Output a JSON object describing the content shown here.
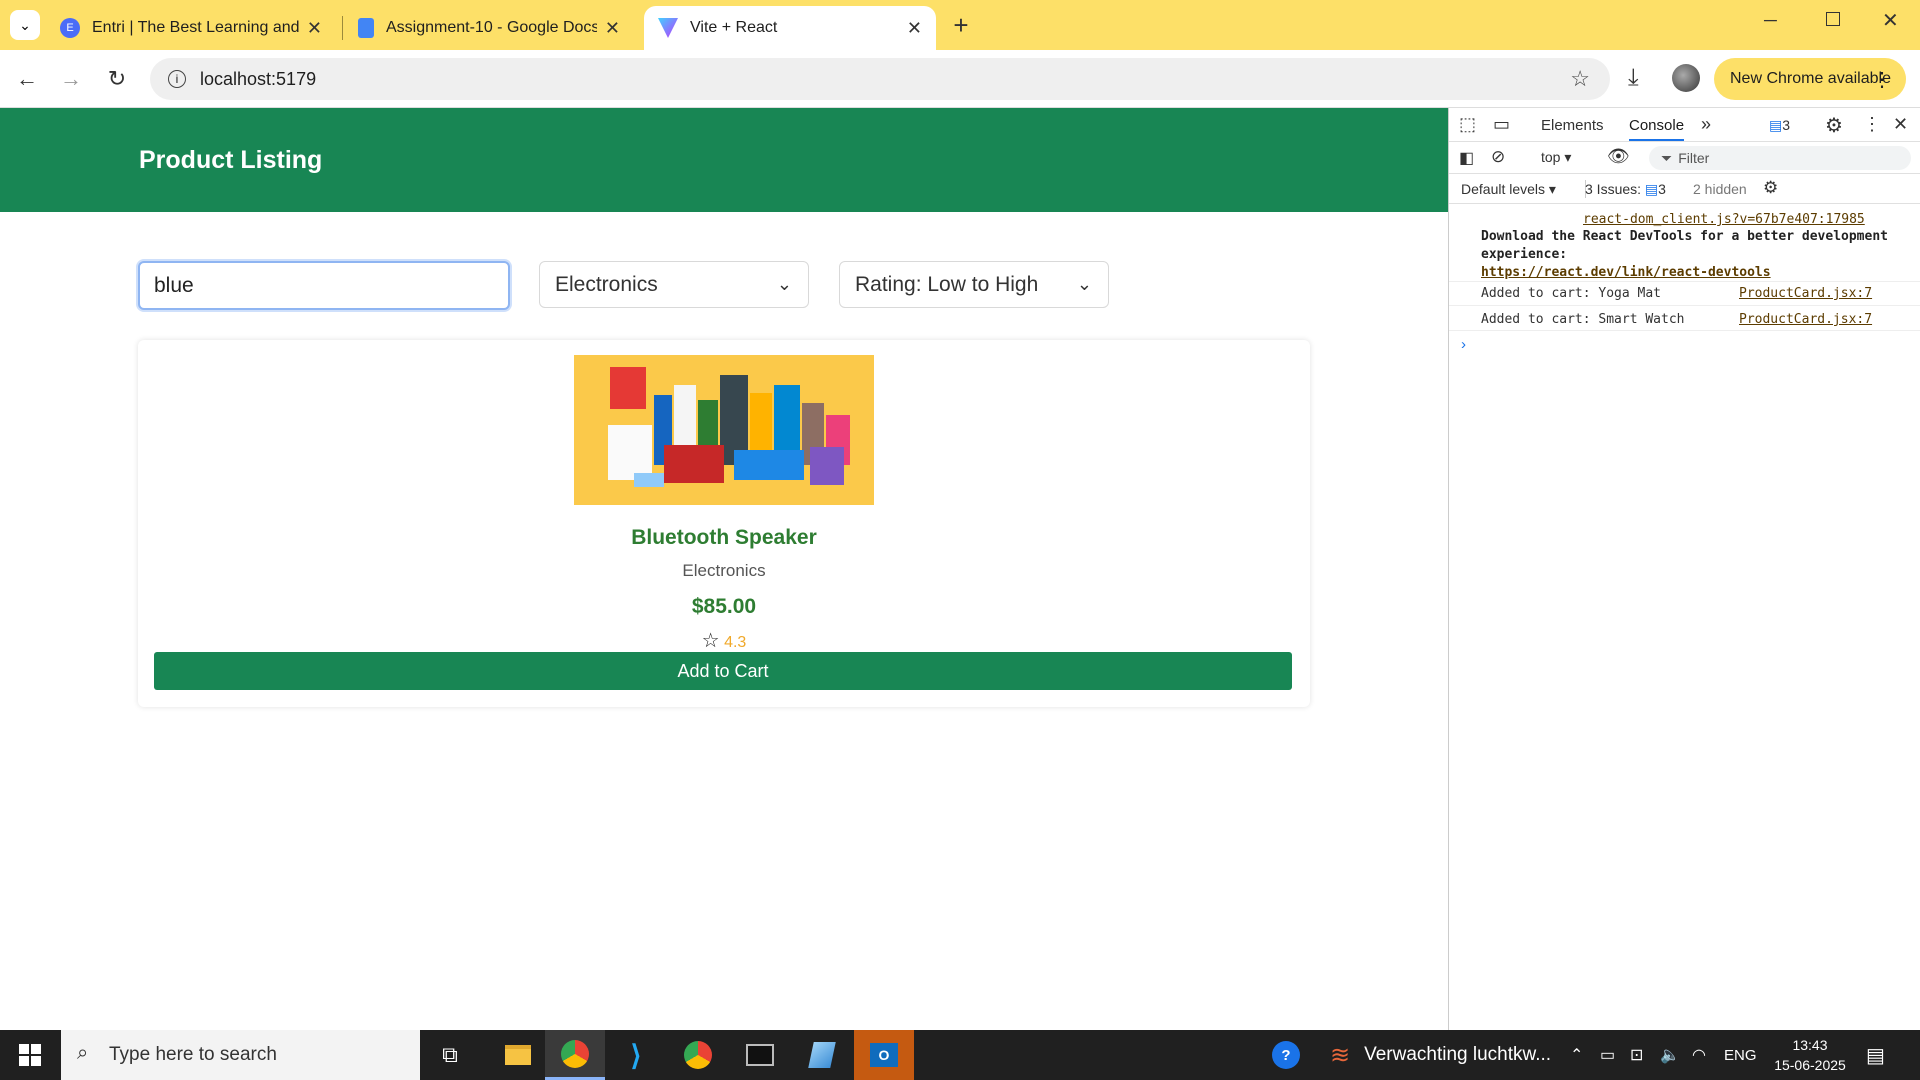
{
  "browser": {
    "tabs": [
      {
        "title": "Entri | The Best Learning and Pr",
        "active": false,
        "favicon_color": "#4a6cf7"
      },
      {
        "title": "Assignment-10 - Google Docs",
        "active": false,
        "favicon_color": "#4285f4"
      },
      {
        "title": "Vite + React",
        "active": true,
        "favicon_color": "#a259ff"
      }
    ],
    "url": "localhost:5179",
    "new_chrome_label": "New Chrome available"
  },
  "app": {
    "title": "Product Listing",
    "search_value": "blue",
    "category_select": "Electronics",
    "sort_select": "Rating: Low to High",
    "product": {
      "name": "Bluetooth Speaker",
      "category": "Electronics",
      "price": "$85.00",
      "rating": "4.3",
      "add_label": "Add to Cart"
    },
    "colors": {
      "brand": "#188654",
      "accent_text": "#2e7d32",
      "rating": "#f0a92b"
    }
  },
  "devtools": {
    "tabs": [
      "Elements",
      "Console"
    ],
    "active_tab": "Console",
    "issues_count": "3",
    "context": "top",
    "filter_placeholder": "Filter",
    "levels": "Default levels",
    "issues_label": "3 Issues:",
    "issues_badge": "3",
    "hidden_label": "2 hidden",
    "messages": [
      {
        "text": "",
        "source": "react-dom_client.js?v=67b7e407:17985"
      },
      {
        "text": "Download the React DevTools for a better development experience:",
        "link": "https://react.dev/link/react-devtools"
      },
      {
        "text": "Added to cart: Yoga Mat",
        "source": "ProductCard.jsx:7"
      },
      {
        "text": "Added to cart: Smart Watch",
        "source": "ProductCard.jsx:7"
      }
    ]
  },
  "taskbar": {
    "search_placeholder": "Type here to search",
    "weather_text": "Verwachting luchtkw...",
    "language": "ENG",
    "time": "13:43",
    "date": "15-06-2025"
  }
}
